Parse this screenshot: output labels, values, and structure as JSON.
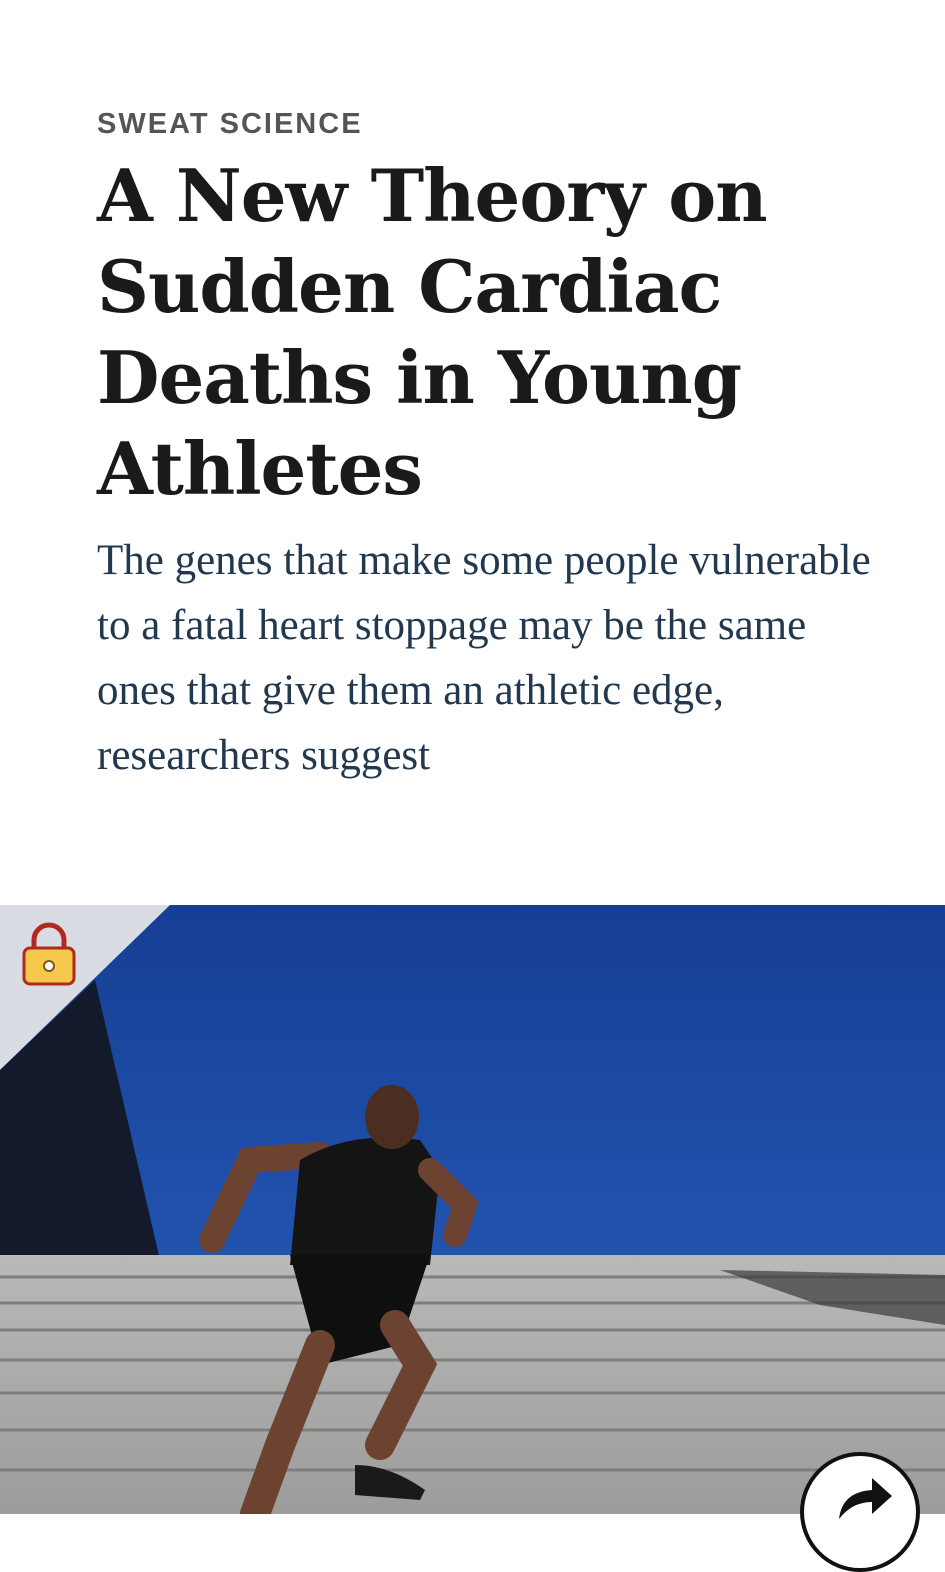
{
  "article": {
    "kicker": "SWEAT SCIENCE",
    "headline": "A New Theory on Sudden Cardiac Deaths in Young Athletes",
    "dek": "The genes that make some people vulnerable to a fatal heart stoppage may be the same ones that give them an athletic edge, researchers suggest"
  },
  "hero_image": {
    "subject": "runner sprinting up stone stairs under a blue sky",
    "badge_icon": "lock-icon"
  },
  "actions": {
    "share_icon": "share-arrow-icon"
  },
  "colors": {
    "kicker": "#555555",
    "headline": "#1a1a1a",
    "dek": "#22384f",
    "sky": "#1f4ea8"
  }
}
